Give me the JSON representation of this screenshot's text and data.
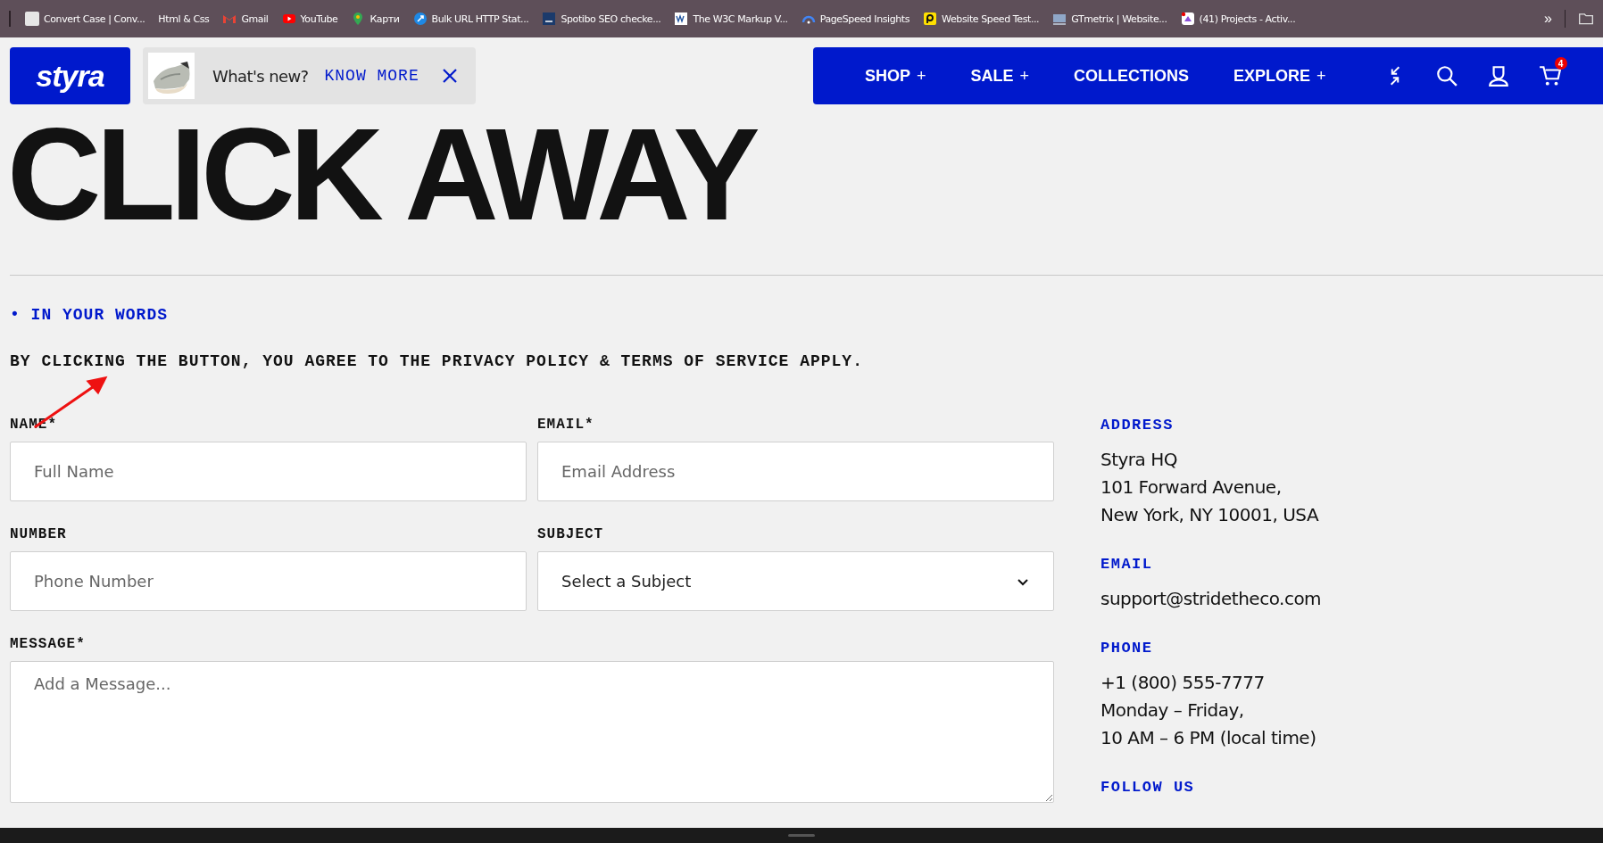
{
  "bookmarks": [
    {
      "label": "Convert Case | Conv..."
    },
    {
      "label": "Html & Css"
    },
    {
      "label": "Gmail"
    },
    {
      "label": "YouTube"
    },
    {
      "label": "Карти"
    },
    {
      "label": "Bulk URL HTTP Stat..."
    },
    {
      "label": "Spotibo SEO checke..."
    },
    {
      "label": "The W3C Markup V..."
    },
    {
      "label": "PageSpeed Insights"
    },
    {
      "label": "Website Speed Test..."
    },
    {
      "label": "GTmetrix | Website..."
    },
    {
      "label": "(41) Projects - Activ..."
    }
  ],
  "bookmarks_more": "»",
  "header": {
    "logo": "styra",
    "promo": {
      "text": "What's new?",
      "link": "KNOW MORE"
    },
    "nav": [
      {
        "label": "SHOP",
        "marker": "+"
      },
      {
        "label": "SALE",
        "marker": "+"
      },
      {
        "label": "COLLECTIONS"
      },
      {
        "label": "EXPLORE",
        "marker": "+"
      }
    ],
    "cart_count": "4"
  },
  "hero_title": "CLICK AWAY",
  "eyebrow": "• IN YOUR WORDS",
  "disclaimer": "BY CLICKING THE BUTTON, YOU AGREE TO THE PRIVACY POLICY & TERMS OF SERVICE APPLY.",
  "form": {
    "fields": [
      {
        "label": "NAME*",
        "placeholder": "Full Name",
        "kind": "input"
      },
      {
        "label": "EMAIL*",
        "placeholder": "Email Address",
        "kind": "input"
      },
      {
        "label": "NUMBER",
        "placeholder": "Phone Number",
        "kind": "input"
      },
      {
        "label": "SUBJECT",
        "value": "Select a Subject",
        "kind": "select"
      },
      {
        "label": "MESSAGE*",
        "placeholder": "Add a Message...",
        "kind": "textarea"
      }
    ]
  },
  "contact": [
    {
      "heading": "ADDRESS",
      "lines": [
        "Styra HQ",
        "101 Forward Avenue,",
        "New York, NY 10001, USA"
      ]
    },
    {
      "heading": "EMAIL",
      "lines": [
        "support@stridetheco.com"
      ]
    },
    {
      "heading": "PHONE",
      "lines": [
        "+1 (800) 555-7777",
        "Monday – Friday,",
        "10 AM – 6 PM (local time)"
      ]
    },
    {
      "heading": "FOLLOW US"
    }
  ]
}
